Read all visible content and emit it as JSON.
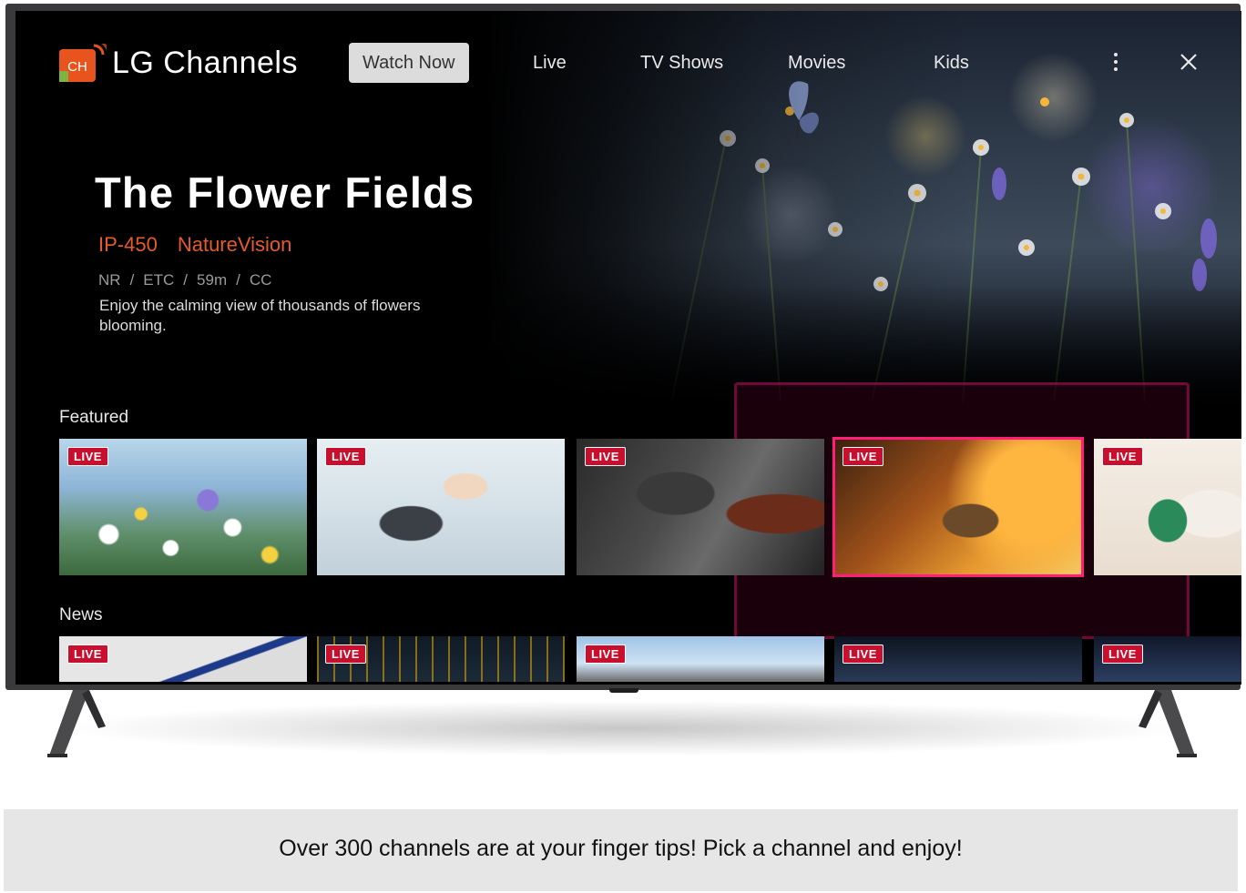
{
  "app": {
    "title": "LG Channels",
    "logo_text": "CH"
  },
  "nav": {
    "tabs": [
      {
        "label": "Watch Now",
        "active": true
      },
      {
        "label": "Live",
        "active": false
      },
      {
        "label": "TV Shows",
        "active": false
      },
      {
        "label": "Movies",
        "active": false
      },
      {
        "label": "Kids",
        "active": false
      }
    ],
    "more_icon": "vertical-dots-icon",
    "close_icon": "close-icon"
  },
  "hero": {
    "title": "The Flower Fields",
    "channel_number": "IP-450",
    "channel_name": "NatureVision",
    "rating": "NR",
    "time_zone": "ETC",
    "duration": "59m",
    "captions": "CC",
    "meta_separator": "/",
    "description": "Enjoy the calming view of thousands of flowers blooming."
  },
  "rows": {
    "featured": {
      "label": "Featured",
      "tiles": [
        {
          "badge": "LIVE"
        },
        {
          "badge": "LIVE"
        },
        {
          "badge": "LIVE"
        },
        {
          "badge": "LIVE",
          "selected": true
        },
        {
          "badge": "LIVE"
        }
      ]
    },
    "news": {
      "label": "News",
      "tiles": [
        {
          "badge": "LIVE"
        },
        {
          "badge": "LIVE"
        },
        {
          "badge": "LIVE"
        },
        {
          "badge": "LIVE"
        },
        {
          "badge": "LIVE"
        }
      ]
    }
  },
  "caption": "Over 300 channels are at your finger tips! Pick a channel and enjoy!",
  "colors": {
    "accent_orange": "#e85a2a",
    "live_badge": "#c8102e",
    "focus_pink": "#ff1f7a"
  }
}
